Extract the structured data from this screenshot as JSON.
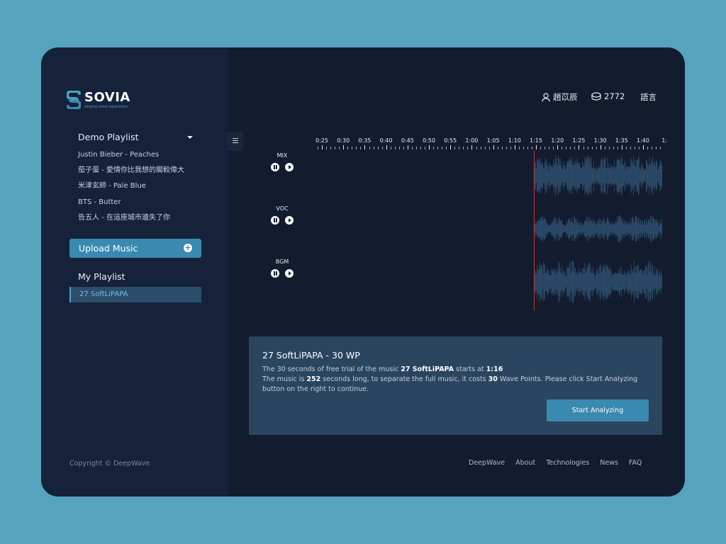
{
  "app": {
    "logo_name": "SOVIA",
    "logo_tagline": "singing voice separation"
  },
  "sidebar": {
    "demo_title": "Demo Playlist",
    "demo_items": [
      "Justin Bieber - Peaches",
      "茄子蛋 - 愛情你比我想的閣較偉大",
      "米津玄師 - Pale Blue",
      "BTS - Butter",
      "告五人 - 在這座城市遺失了你"
    ],
    "upload_label": "Upload Music",
    "my_title": "My Playlist",
    "my_items": [
      "27 SoftLiPAPA"
    ],
    "copyright": "Copyright © DeepWave"
  },
  "topnav": {
    "user_name": "趙苡辰",
    "points": "2772",
    "language": "語言"
  },
  "timeline": {
    "labels": [
      "0:25",
      "0:30",
      "0:35",
      "0:40",
      "0:45",
      "0:50",
      "0:55",
      "1:00",
      "1:05",
      "1:10",
      "1:15",
      "1:20",
      "1:25",
      "1:30",
      "1:35",
      "1:40",
      "1:"
    ]
  },
  "tracks": [
    {
      "label": "MIX"
    },
    {
      "label": "VOC"
    },
    {
      "label": "BGM"
    }
  ],
  "colors": {
    "accent": "#3a89b0",
    "waveform": "#2d4d6d",
    "playhead": "#c0392b"
  },
  "info": {
    "title": "27 SoftLiPAPA - 30 WP",
    "line1_pre": "The 30 seconds of free trial of the music ",
    "line1_track": "27 SoftLiPAPA",
    "line1_mid": " starts at ",
    "line1_time": "1:16",
    "line2_pre": "The music is ",
    "line2_seconds": "252",
    "line2_mid": " seconds long, to separate the full music, it costs ",
    "line2_points": "30",
    "line2_post": " Wave Points. Please click Start Analyzing button on the right to continue.",
    "button_label": "Start Analyzing"
  },
  "footer": {
    "links": [
      "DeepWave",
      "About",
      "Technologies",
      "News",
      "FAQ"
    ]
  }
}
